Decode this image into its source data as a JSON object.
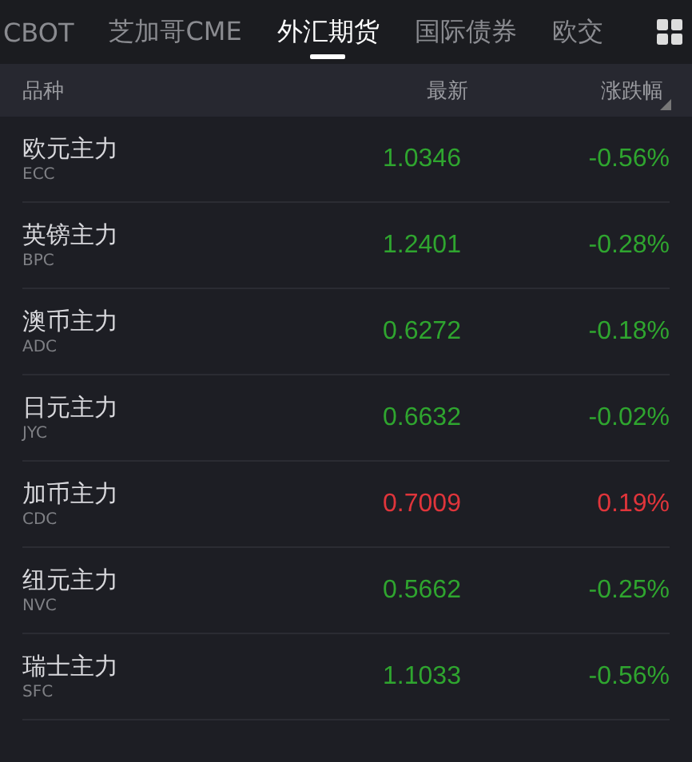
{
  "tabs": [
    {
      "label": "CBOT",
      "selected": false
    },
    {
      "label": "芝加哥CME",
      "selected": false
    },
    {
      "label": "外汇期货",
      "selected": true
    },
    {
      "label": "国际债券",
      "selected": false
    },
    {
      "label": "欧交",
      "selected": false
    }
  ],
  "table": {
    "columns": [
      "品种",
      "最新",
      "涨跌幅"
    ],
    "rows": [
      {
        "name": "欧元主力",
        "code": "ECC",
        "price": "1.0346",
        "change": "-0.56%",
        "color": "#2fa52f"
      },
      {
        "name": "英镑主力",
        "code": "BPC",
        "price": "1.2401",
        "change": "-0.28%",
        "color": "#2fa52f"
      },
      {
        "name": "澳币主力",
        "code": "ADC",
        "price": "0.6272",
        "change": "-0.18%",
        "color": "#2fa52f"
      },
      {
        "name": "日元主力",
        "code": "JYC",
        "price": "0.6632",
        "change": "-0.02%",
        "color": "#2fa52f"
      },
      {
        "name": "加币主力",
        "code": "CDC",
        "price": "0.7009",
        "change": "0.19%",
        "color": "#e0353b"
      },
      {
        "name": "纽元主力",
        "code": "NVC",
        "price": "0.5662",
        "change": "-0.25%",
        "color": "#2fa52f"
      },
      {
        "name": "瑞士主力",
        "code": "SFC",
        "price": "1.1033",
        "change": "-0.56%",
        "color": "#2fa52f"
      }
    ]
  }
}
